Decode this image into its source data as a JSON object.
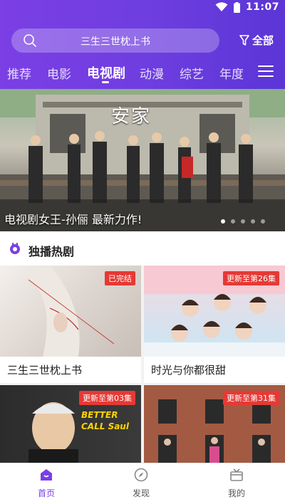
{
  "status": {
    "time": "11:07"
  },
  "search": {
    "text": "三生三世枕上书"
  },
  "filter": {
    "label": "全部"
  },
  "tabs": [
    "推荐",
    "电影",
    "电视剧",
    "动漫",
    "综艺",
    "年度"
  ],
  "banner": {
    "sign_text": "安家",
    "caption": "电视剧女王-孙俪 最新力作!",
    "dot_count": 5,
    "active_dot": 0
  },
  "section": {
    "title": "独播热剧"
  },
  "cards": [
    {
      "title": "三生三世枕上书",
      "badge": "已完结"
    },
    {
      "title": "时光与你都很甜",
      "badge": "更新至第26集"
    },
    {
      "title": "",
      "badge": "更新至第03集",
      "poster_text": "BETTER CALL Saul"
    },
    {
      "title": "",
      "badge": "更新至第31集"
    }
  ],
  "bottom_nav": [
    {
      "label": "首页",
      "icon": "home-icon",
      "active": true
    },
    {
      "label": "发现",
      "icon": "compass-icon",
      "active": false
    },
    {
      "label": "我的",
      "icon": "profile-icon",
      "active": false
    }
  ],
  "colors": {
    "accent": "#7b3fe4",
    "badge": "#e53935"
  }
}
